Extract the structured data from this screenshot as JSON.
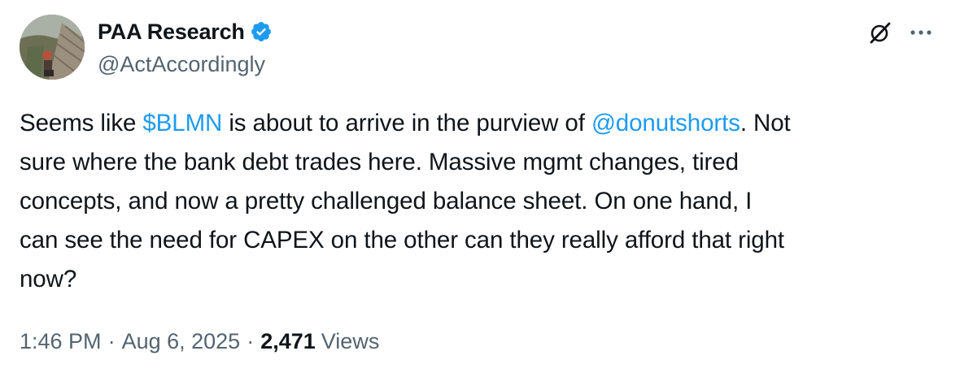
{
  "author": {
    "display_name": "PAA Research",
    "handle": "@ActAccordingly",
    "verified": true
  },
  "icons": {
    "verified": "verified-badge-icon",
    "grok": "grok-slash-icon",
    "more": "more-horizontal-icon"
  },
  "colors": {
    "link": "#1d9bf0",
    "text": "#0f1419",
    "secondary": "#536471"
  },
  "tweet": {
    "lines": [
      [
        "Seems like ",
        "$BLMN",
        " is about to arrive in the purview of ",
        "@donutshorts",
        ". Not"
      ],
      [
        "sure where the bank debt trades here. Massive mgmt changes, tired"
      ],
      [
        "concepts, and now a pretty challenged balance sheet. On one hand, I"
      ],
      [
        "can see the need for CAPEX on the other can they really afford that right"
      ],
      [
        "now?"
      ]
    ],
    "cashtag": "$BLMN",
    "mention": "@donutshorts"
  },
  "meta": {
    "time": "1:46 PM",
    "separator": "·",
    "date": "Aug 6, 2025",
    "views_count": "2,471",
    "views_label": "Views"
  }
}
